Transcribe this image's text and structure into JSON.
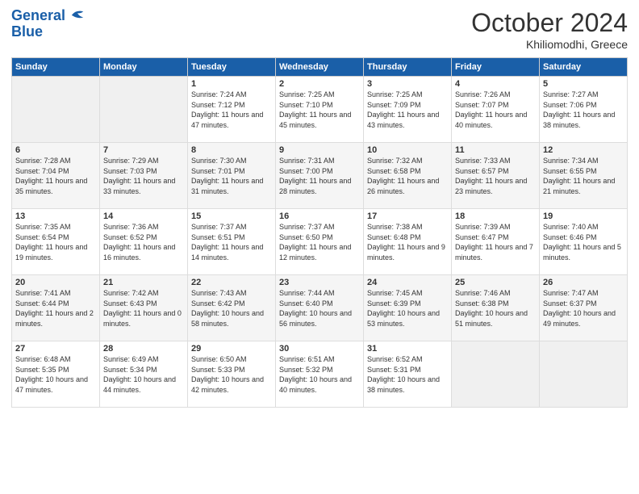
{
  "logo": {
    "line1": "General",
    "line2": "Blue"
  },
  "header": {
    "month": "October 2024",
    "location": "Khiliomodhi, Greece"
  },
  "weekdays": [
    "Sunday",
    "Monday",
    "Tuesday",
    "Wednesday",
    "Thursday",
    "Friday",
    "Saturday"
  ],
  "weeks": [
    [
      {
        "day": "",
        "info": ""
      },
      {
        "day": "",
        "info": ""
      },
      {
        "day": "1",
        "info": "Sunrise: 7:24 AM\nSunset: 7:12 PM\nDaylight: 11 hours and 47 minutes."
      },
      {
        "day": "2",
        "info": "Sunrise: 7:25 AM\nSunset: 7:10 PM\nDaylight: 11 hours and 45 minutes."
      },
      {
        "day": "3",
        "info": "Sunrise: 7:25 AM\nSunset: 7:09 PM\nDaylight: 11 hours and 43 minutes."
      },
      {
        "day": "4",
        "info": "Sunrise: 7:26 AM\nSunset: 7:07 PM\nDaylight: 11 hours and 40 minutes."
      },
      {
        "day": "5",
        "info": "Sunrise: 7:27 AM\nSunset: 7:06 PM\nDaylight: 11 hours and 38 minutes."
      }
    ],
    [
      {
        "day": "6",
        "info": "Sunrise: 7:28 AM\nSunset: 7:04 PM\nDaylight: 11 hours and 35 minutes."
      },
      {
        "day": "7",
        "info": "Sunrise: 7:29 AM\nSunset: 7:03 PM\nDaylight: 11 hours and 33 minutes."
      },
      {
        "day": "8",
        "info": "Sunrise: 7:30 AM\nSunset: 7:01 PM\nDaylight: 11 hours and 31 minutes."
      },
      {
        "day": "9",
        "info": "Sunrise: 7:31 AM\nSunset: 7:00 PM\nDaylight: 11 hours and 28 minutes."
      },
      {
        "day": "10",
        "info": "Sunrise: 7:32 AM\nSunset: 6:58 PM\nDaylight: 11 hours and 26 minutes."
      },
      {
        "day": "11",
        "info": "Sunrise: 7:33 AM\nSunset: 6:57 PM\nDaylight: 11 hours and 23 minutes."
      },
      {
        "day": "12",
        "info": "Sunrise: 7:34 AM\nSunset: 6:55 PM\nDaylight: 11 hours and 21 minutes."
      }
    ],
    [
      {
        "day": "13",
        "info": "Sunrise: 7:35 AM\nSunset: 6:54 PM\nDaylight: 11 hours and 19 minutes."
      },
      {
        "day": "14",
        "info": "Sunrise: 7:36 AM\nSunset: 6:52 PM\nDaylight: 11 hours and 16 minutes."
      },
      {
        "day": "15",
        "info": "Sunrise: 7:37 AM\nSunset: 6:51 PM\nDaylight: 11 hours and 14 minutes."
      },
      {
        "day": "16",
        "info": "Sunrise: 7:37 AM\nSunset: 6:50 PM\nDaylight: 11 hours and 12 minutes."
      },
      {
        "day": "17",
        "info": "Sunrise: 7:38 AM\nSunset: 6:48 PM\nDaylight: 11 hours and 9 minutes."
      },
      {
        "day": "18",
        "info": "Sunrise: 7:39 AM\nSunset: 6:47 PM\nDaylight: 11 hours and 7 minutes."
      },
      {
        "day": "19",
        "info": "Sunrise: 7:40 AM\nSunset: 6:46 PM\nDaylight: 11 hours and 5 minutes."
      }
    ],
    [
      {
        "day": "20",
        "info": "Sunrise: 7:41 AM\nSunset: 6:44 PM\nDaylight: 11 hours and 2 minutes."
      },
      {
        "day": "21",
        "info": "Sunrise: 7:42 AM\nSunset: 6:43 PM\nDaylight: 11 hours and 0 minutes."
      },
      {
        "day": "22",
        "info": "Sunrise: 7:43 AM\nSunset: 6:42 PM\nDaylight: 10 hours and 58 minutes."
      },
      {
        "day": "23",
        "info": "Sunrise: 7:44 AM\nSunset: 6:40 PM\nDaylight: 10 hours and 56 minutes."
      },
      {
        "day": "24",
        "info": "Sunrise: 7:45 AM\nSunset: 6:39 PM\nDaylight: 10 hours and 53 minutes."
      },
      {
        "day": "25",
        "info": "Sunrise: 7:46 AM\nSunset: 6:38 PM\nDaylight: 10 hours and 51 minutes."
      },
      {
        "day": "26",
        "info": "Sunrise: 7:47 AM\nSunset: 6:37 PM\nDaylight: 10 hours and 49 minutes."
      }
    ],
    [
      {
        "day": "27",
        "info": "Sunrise: 6:48 AM\nSunset: 5:35 PM\nDaylight: 10 hours and 47 minutes."
      },
      {
        "day": "28",
        "info": "Sunrise: 6:49 AM\nSunset: 5:34 PM\nDaylight: 10 hours and 44 minutes."
      },
      {
        "day": "29",
        "info": "Sunrise: 6:50 AM\nSunset: 5:33 PM\nDaylight: 10 hours and 42 minutes."
      },
      {
        "day": "30",
        "info": "Sunrise: 6:51 AM\nSunset: 5:32 PM\nDaylight: 10 hours and 40 minutes."
      },
      {
        "day": "31",
        "info": "Sunrise: 6:52 AM\nSunset: 5:31 PM\nDaylight: 10 hours and 38 minutes."
      },
      {
        "day": "",
        "info": ""
      },
      {
        "day": "",
        "info": ""
      }
    ]
  ]
}
